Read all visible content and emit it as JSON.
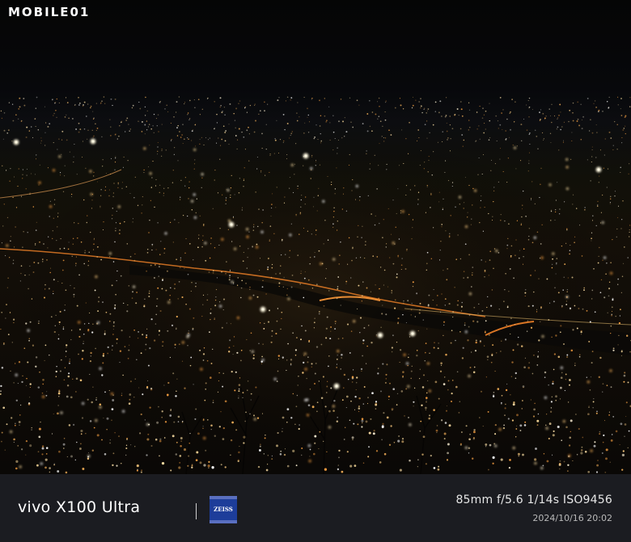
{
  "photo": {
    "description_icon": "night-cityscape-photo",
    "watermark": "MOBILE01"
  },
  "caption": {
    "brand": "vivo X100 Ultra",
    "lens_logo": "ZEISS",
    "params": "85mm  f/5.6  1/14s  ISO9456",
    "datetime": "2024/10/16 20:02"
  },
  "colors": {
    "bar_bg": "#1b1c21",
    "zeiss_blue": "#1d3d9a",
    "light_warm": "#ffcf82",
    "light_white": "#fff3d6"
  }
}
